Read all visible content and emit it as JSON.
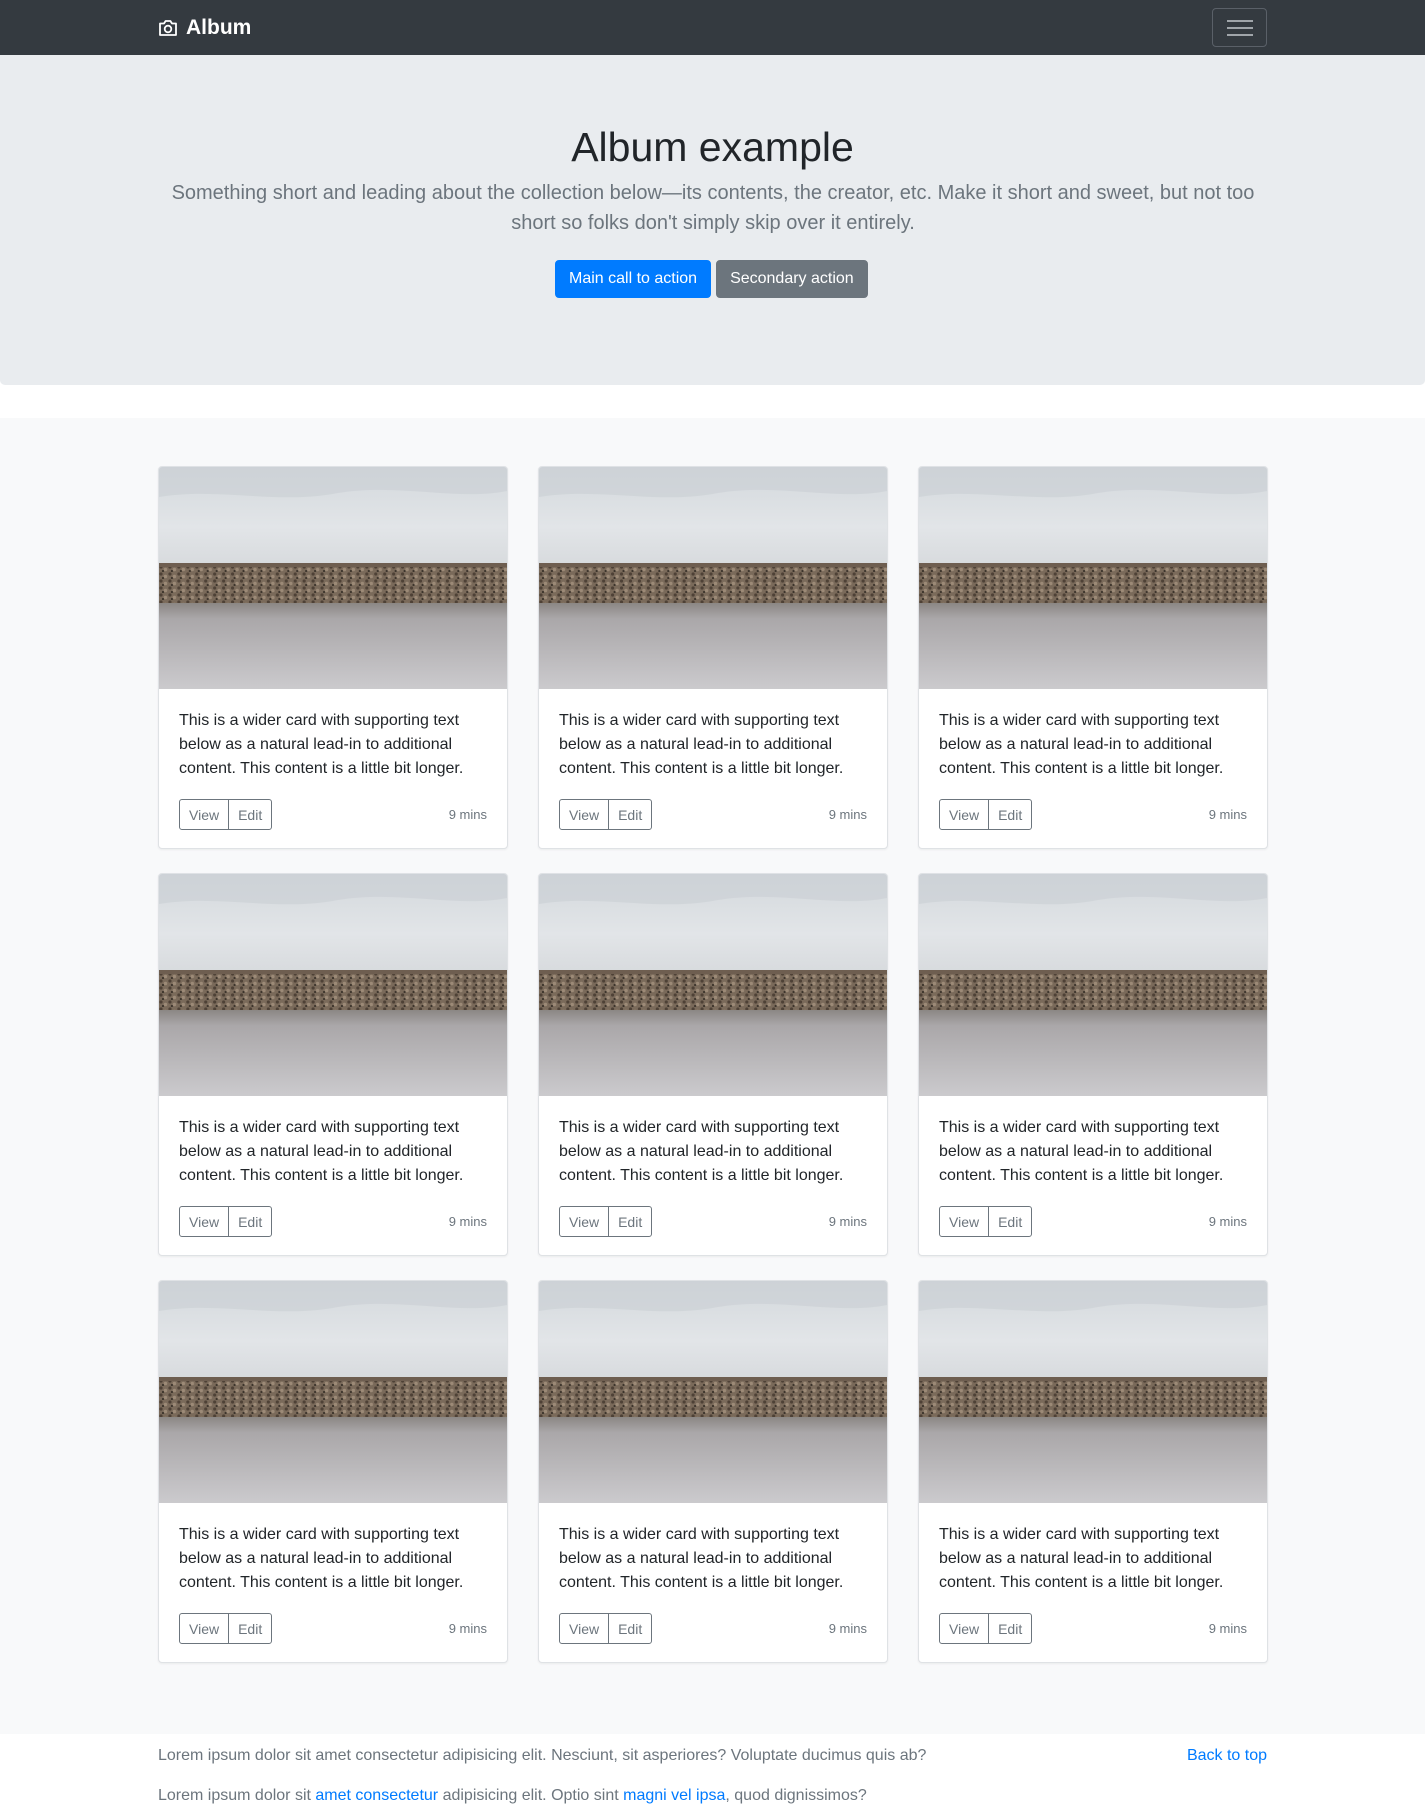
{
  "navbar": {
    "brand": "Album",
    "brand_icon": "camera-icon",
    "menu_icon": "hamburger-icon"
  },
  "hero": {
    "title": "Album example",
    "lead": "Something short and leading about the collection below—its contents, the creator, etc. Make it short and sweet, but not too short so folks don't simply skip over it entirely.",
    "primary_label": "Main call to action",
    "secondary_label": "Secondary action"
  },
  "cards": [
    {
      "text": "This is a wider card with supporting text below as a natural lead-in to additional content. This content is a little bit longer.",
      "view_label": "View",
      "edit_label": "Edit",
      "time": "9 mins"
    },
    {
      "text": "This is a wider card with supporting text below as a natural lead-in to additional content. This content is a little bit longer.",
      "view_label": "View",
      "edit_label": "Edit",
      "time": "9 mins"
    },
    {
      "text": "This is a wider card with supporting text below as a natural lead-in to additional content. This content is a little bit longer.",
      "view_label": "View",
      "edit_label": "Edit",
      "time": "9 mins"
    },
    {
      "text": "This is a wider card with supporting text below as a natural lead-in to additional content. This content is a little bit longer.",
      "view_label": "View",
      "edit_label": "Edit",
      "time": "9 mins"
    },
    {
      "text": "This is a wider card with supporting text below as a natural lead-in to additional content. This content is a little bit longer.",
      "view_label": "View",
      "edit_label": "Edit",
      "time": "9 mins"
    },
    {
      "text": "This is a wider card with supporting text below as a natural lead-in to additional content. This content is a little bit longer.",
      "view_label": "View",
      "edit_label": "Edit",
      "time": "9 mins"
    },
    {
      "text": "This is a wider card with supporting text below as a natural lead-in to additional content. This content is a little bit longer.",
      "view_label": "View",
      "edit_label": "Edit",
      "time": "9 mins"
    },
    {
      "text": "This is a wider card with supporting text below as a natural lead-in to additional content. This content is a little bit longer.",
      "view_label": "View",
      "edit_label": "Edit",
      "time": "9 mins"
    },
    {
      "text": "This is a wider card with supporting text below as a natural lead-in to additional content. This content is a little bit longer.",
      "view_label": "View",
      "edit_label": "Edit",
      "time": "9 mins"
    }
  ],
  "footer": {
    "line1": "Lorem ipsum dolor sit amet consectetur adipisicing elit. Nesciunt, sit asperiores? Voluptate ducimus quis ab?",
    "back_to_top": "Back to top",
    "line2_part1": "Lorem ipsum dolor sit ",
    "line2_link1": "amet consectetur",
    "line2_part2": " adipisicing elit. Optio sint ",
    "line2_link2": "magni vel ipsa",
    "line2_part3": ", quod dignissimos?"
  },
  "colors": {
    "navbar_bg": "#343a40",
    "hero_bg": "#e9ecef",
    "primary": "#007bff",
    "secondary": "#6c757d",
    "album_bg": "#f8f9fa"
  }
}
